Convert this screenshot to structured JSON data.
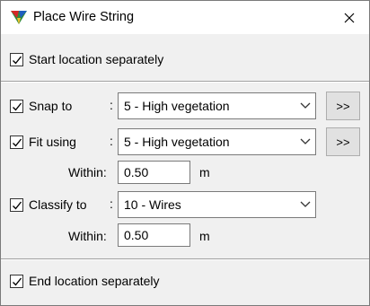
{
  "window": {
    "title": "Place Wire String",
    "close_icon": "close-icon",
    "app_icon": "terrasolid-app-icon"
  },
  "start": {
    "label": "Start location separately",
    "checked": true
  },
  "snap": {
    "label": "Snap to",
    "colon": ":",
    "value": "5 - High vegetation",
    "more": ">>",
    "checked": true
  },
  "fit": {
    "label": "Fit using",
    "colon": ":",
    "value": "5 - High vegetation",
    "more": ">>",
    "checked": true,
    "within_label": "Within:",
    "within_value": "0.50",
    "unit": "m"
  },
  "classify": {
    "label": "Classify to",
    "colon": ":",
    "value": "10 - Wires",
    "checked": true,
    "within_label": "Within:",
    "within_value": "0.50",
    "unit": "m"
  },
  "end": {
    "label": "End location separately",
    "checked": true
  },
  "colors": {
    "check": "#000000",
    "border": "#7a7a7a",
    "button_bg": "#e1e1e1"
  }
}
